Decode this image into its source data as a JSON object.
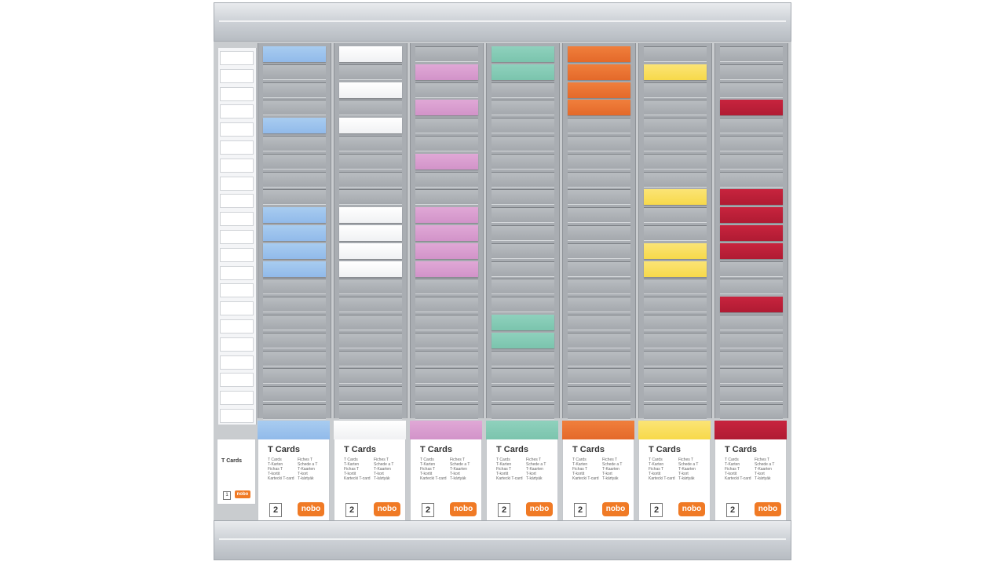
{
  "board": {
    "columns": [
      {
        "color": "#9dc4ee",
        "color_name": "blue",
        "card_class": "card-blue",
        "cards": [
          0,
          4,
          9,
          10,
          11,
          12
        ]
      },
      {
        "color": "#ffffff",
        "color_name": "white",
        "card_class": "card-white",
        "cards": [
          0,
          2,
          4,
          9,
          10,
          11,
          12
        ]
      },
      {
        "color": "#d89ccf",
        "color_name": "pink",
        "card_class": "card-pink",
        "cards": [
          1,
          3,
          6,
          9,
          10,
          11,
          12
        ]
      },
      {
        "color": "#86cbb6",
        "color_name": "green",
        "card_class": "card-green",
        "cards": [
          0,
          1,
          15,
          16
        ]
      },
      {
        "color": "#ea7433",
        "color_name": "orange",
        "card_class": "card-orange",
        "cards": [
          0,
          1,
          2,
          3
        ]
      },
      {
        "color": "#f9df5d",
        "color_name": "yellow",
        "card_class": "card-yellow",
        "cards": [
          1,
          8,
          11,
          12
        ]
      },
      {
        "color": "#bd2039",
        "color_name": "red",
        "card_class": "card-red",
        "cards": [
          3,
          8,
          9,
          10,
          11,
          14
        ]
      }
    ]
  },
  "packs": [
    {
      "title": "T Cards",
      "desc_left": "T Cards\nT-Karten\nFichas T\nT-kortit\nKartecki T-card",
      "desc_right": "Fiches T\nSchede a T\nT-Kaarten\nT-kort\nT-kártyák",
      "quantity": "2",
      "brand": "nobo"
    },
    {
      "title": "T Cards",
      "desc_left": "T Cards\nT-Karten\nFichas T\nT-kortit\nKartecki T-card",
      "desc_right": "Fiches T\nSchede a T\nT-Kaarten\nT-kort\nT-kártyák",
      "quantity": "2",
      "brand": "nobo"
    },
    {
      "title": "T Cards",
      "desc_left": "T Cards\nT-Karten\nFichas T\nT-kortit\nKartecki T-card",
      "desc_right": "Fiches T\nSchede a T\nT-Kaarten\nT-kort\nT-kártyák",
      "quantity": "2",
      "brand": "nobo"
    },
    {
      "title": "T Cards",
      "desc_left": "T Cards\nT-Karten\nFichas T\nT-kortit\nKartecki T-card",
      "desc_right": "Fiches T\nSchede a T\nT-Kaarten\nT-kort\nT-kártyák",
      "quantity": "2",
      "brand": "nobo"
    },
    {
      "title": "T Cards",
      "desc_left": "T Cards\nT-Karten\nFichas T\nT-kortit\nKartecki T-card",
      "desc_right": "Fiches T\nSchede a T\nT-Kaarten\nT-kort\nT-kártyák",
      "quantity": "2",
      "brand": "nobo"
    },
    {
      "title": "T Cards",
      "desc_left": "T Cards\nT-Karten\nFichas T\nT-kortit\nKartecki T-card",
      "desc_right": "Fiches T\nSchede a T\nT-Kaarten\nT-kort\nT-kártyák",
      "quantity": "2",
      "brand": "nobo"
    },
    {
      "title": "T Cards",
      "desc_left": "T Cards\nT-Karten\nFichas T\nT-kortit\nKartecki T-card",
      "desc_right": "Fiches T\nSchede a T\nT-Kaarten\nT-kort\nT-kártyák",
      "quantity": "2",
      "brand": "nobo"
    }
  ],
  "small_pack": {
    "title": "T Cards",
    "quantity": "1",
    "brand": "nobo"
  }
}
